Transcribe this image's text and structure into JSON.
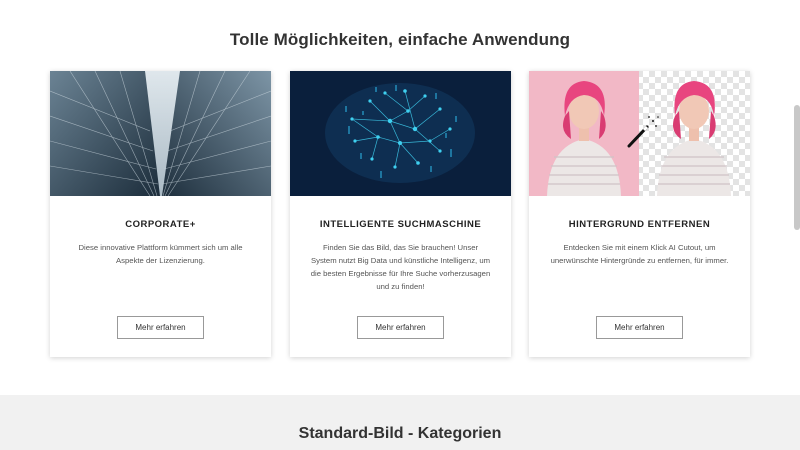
{
  "section": {
    "heading": "Tolle Möglichkeiten, einfache Anwendung"
  },
  "cards": [
    {
      "title": "CORPORATE+",
      "description": "Diese innovative Plattform kümmert sich um alle Aspekte der Lizenzierung.",
      "button": "Mehr erfahren",
      "image": "glass-skyscrapers-photo"
    },
    {
      "title": "INTELLIGENTE SUCHMASCHINE",
      "description": "Finden Sie das Bild, das Sie brauchen! Unser System nutzt Big Data und künstliche Intelligenz, um die besten Ergebnisse für Ihre Suche vorherzusagen und zu finden!",
      "button": "Mehr erfahren",
      "image": "digital-brain-network"
    },
    {
      "title": "HINTERGRUND ENTFERNEN",
      "description": "Entdecken Sie mit einem Klick AI Cutout, um unerwünschte Hintergründe zu entfernen, für immer.",
      "button": "Mehr erfahren",
      "image": "background-removal-before-after"
    }
  ],
  "footer": {
    "heading": "Standard-Bild - Kategorien"
  },
  "colors": {
    "brain_bg": "#0a1f3c",
    "brain_glow": "#3fd0f0",
    "pink_bg": "#f2b8c6",
    "hair": "#e8457f"
  }
}
